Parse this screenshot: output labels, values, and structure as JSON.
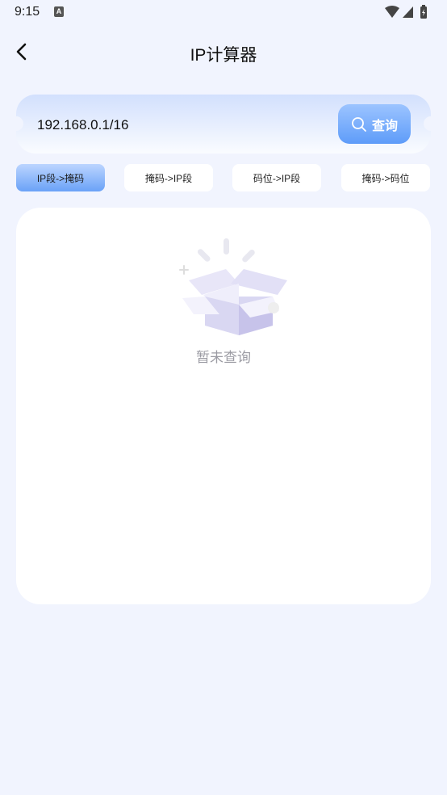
{
  "status_bar": {
    "time": "9:15",
    "notification_badge": "A"
  },
  "header": {
    "title": "IP计算器"
  },
  "search": {
    "value": "192.168.0.1/16",
    "button_label": "查询"
  },
  "tabs": [
    {
      "label": "IP段->掩码",
      "active": true
    },
    {
      "label": "掩码->IP段",
      "active": false
    },
    {
      "label": "码位->IP段",
      "active": false
    },
    {
      "label": "掩码->码位",
      "active": false
    }
  ],
  "result": {
    "empty_text": "暂未查询"
  },
  "colors": {
    "accent": "#5e9cf9",
    "background": "#f1f4fe"
  }
}
